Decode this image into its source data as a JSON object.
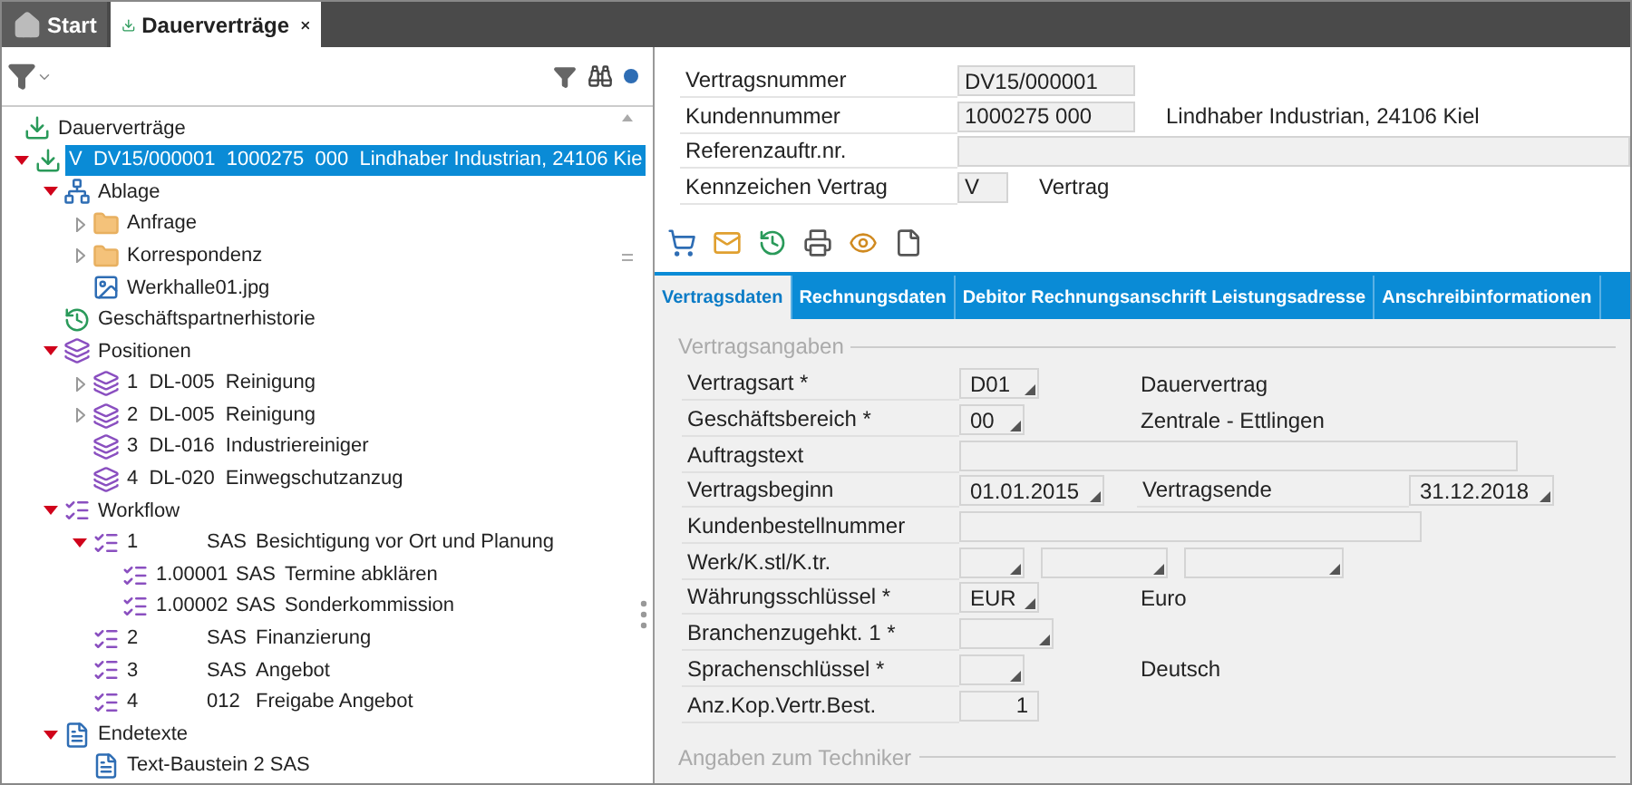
{
  "app_tabs": [
    {
      "label": "Start",
      "selected": false,
      "closable": false
    },
    {
      "label": "Dauerverträge",
      "selected": true,
      "closable": true
    }
  ],
  "tree": [
    {
      "kind": "contract",
      "label": "Dauerverträge",
      "selected": false,
      "children": [
        {
          "kind": "contract",
          "label": "V  DV15/000001  1000275  000  Lindhaber Industrian, 24106 Kie",
          "selected": true,
          "expanded": true,
          "children": [
            {
              "kind": "filing",
              "label": "Ablage",
              "selected": false,
              "expanded": true,
              "children": [
                {
                  "kind": "folder",
                  "label": "Anfrage",
                  "selected": false,
                  "expanded": false
                },
                {
                  "kind": "folder",
                  "label": "Korrespondenz",
                  "selected": false,
                  "expanded": false
                },
                {
                  "kind": "image",
                  "label": "Werkhalle01.jpg",
                  "selected": false
                }
              ]
            },
            {
              "kind": "history",
              "label": "Geschäftspartnerhistorie",
              "selected": false
            },
            {
              "kind": "positions",
              "label": "Positionen",
              "selected": false,
              "expanded": true,
              "children": [
                {
                  "kind": "positions",
                  "label": "1  DL-005  Reinigung",
                  "selected": false,
                  "expanded": false
                },
                {
                  "kind": "positions",
                  "label": "2  DL-005  Reinigung",
                  "selected": false,
                  "expanded": false
                },
                {
                  "kind": "positions",
                  "label": "3  DL-016  Industriereiniger",
                  "selected": false
                },
                {
                  "kind": "positions",
                  "label": "4  DL-020  Einwegschutzanzug",
                  "selected": false
                }
              ]
            },
            {
              "kind": "workflow",
              "label": "Workflow",
              "selected": false,
              "expanded": true,
              "children": [
                {
                  "kind": "task",
                  "number": "1",
                  "code": "SAS",
                  "label": "Besichtigung vor Ort und Planung",
                  "selected": false,
                  "expanded": true,
                  "children": [
                    {
                      "kind": "task",
                      "number": "1.00001",
                      "code": "SAS",
                      "label": "Termine abklären",
                      "selected": false
                    },
                    {
                      "kind": "task",
                      "number": "1.00002",
                      "code": "SAS",
                      "label": "Sonderkommission",
                      "selected": false
                    }
                  ]
                },
                {
                  "kind": "task",
                  "number": "2",
                  "code": "SAS",
                  "label": "Finanzierung",
                  "selected": false
                },
                {
                  "kind": "task",
                  "number": "3",
                  "code": "SAS",
                  "label": "Angebot",
                  "selected": false
                },
                {
                  "kind": "task",
                  "number": "4",
                  "code": "012",
                  "label": "Freigabe Angebot",
                  "selected": false
                }
              ]
            },
            {
              "kind": "documents",
              "label": "Endetexte",
              "selected": false,
              "expanded": true,
              "children": [
                {
                  "kind": "document",
                  "label": "Text-Baustein 2 SAS",
                  "selected": false
                }
              ]
            }
          ]
        }
      ]
    }
  ],
  "header_fields": [
    {
      "label": "Vertragsnummer",
      "value": "DV15/000001",
      "kind": "medium"
    },
    {
      "label": "Kundennummer",
      "value": "1000275 000",
      "kind": "medium",
      "description": "Lindhaber Industrian, 24106 Kiel"
    },
    {
      "label": "Referenzauftr.nr.",
      "kind": "full"
    },
    {
      "label": "Kennzeichen Vertrag",
      "value": "V",
      "kind": "tiny",
      "description": "Vertrag"
    }
  ],
  "toolbar": [
    {
      "kind": "cart"
    },
    {
      "kind": "mail"
    },
    {
      "kind": "history"
    },
    {
      "kind": "print"
    },
    {
      "kind": "view"
    },
    {
      "kind": "document"
    }
  ],
  "form_tabs": [
    {
      "label": "Vertragsdaten",
      "selected": true
    },
    {
      "label": "Rechnungsdaten",
      "selected": false
    },
    {
      "label": "Debitor Rechnungsanschrift Leistungsadresse",
      "selected": false
    },
    {
      "label": "Anschreibinformationen",
      "selected": false
    }
  ],
  "sections": [
    {
      "title": "Vertragsangaben",
      "rows": [
        {
          "label": "Vertragsart *",
          "fields": [
            {
              "value": "D01",
              "kind": "short",
              "dropdown": true
            }
          ],
          "description": "Dauervertrag"
        },
        {
          "label": "Geschäftsbereich *",
          "fields": [
            {
              "value": "00",
              "kind": "tiny",
              "dropdown": true
            }
          ],
          "description": "Zentrale - Ettlingen"
        },
        {
          "label": "Auftragstext",
          "fields": [
            {
              "kind": "long",
              "dropdown": false
            }
          ]
        },
        {
          "label": "Vertragsbeginn",
          "fields": [
            {
              "value": "01.01.2015",
              "kind": "date",
              "dropdown": true
            }
          ],
          "extra": {
            "label": "Vertragsende",
            "field": {
              "value": "31.12.2018",
              "kind": "date",
              "dropdown": true
            }
          }
        },
        {
          "label": "Kundenbestellnummer",
          "fields": [
            {
              "kind": "wide",
              "dropdown": false
            }
          ]
        },
        {
          "label": "Werk/K.stl/K.tr.",
          "fields": [
            {
              "kind": "tiny",
              "dropdown": true
            },
            {
              "kind": "medium",
              "dropdown": true
            },
            {
              "kind": "large",
              "dropdown": true
            }
          ]
        },
        {
          "label": "Währungsschlüssel *",
          "fields": [
            {
              "value": "EUR",
              "kind": "short",
              "dropdown": true
            }
          ],
          "description": "Euro"
        },
        {
          "label": "Branchenzugehkt. 1 *",
          "fields": [
            {
              "kind": "mid",
              "dropdown": true
            }
          ]
        },
        {
          "label": "Sprachenschlüssel *",
          "fields": [
            {
              "kind": "tiny",
              "dropdown": true
            }
          ],
          "description": "Deutsch"
        },
        {
          "label": "Anz.Kop.Vertr.Best.",
          "fields": [
            {
              "value": "1",
              "kind": "number",
              "dropdown": false
            }
          ]
        }
      ]
    },
    {
      "title": "Angaben zum Techniker"
    }
  ]
}
